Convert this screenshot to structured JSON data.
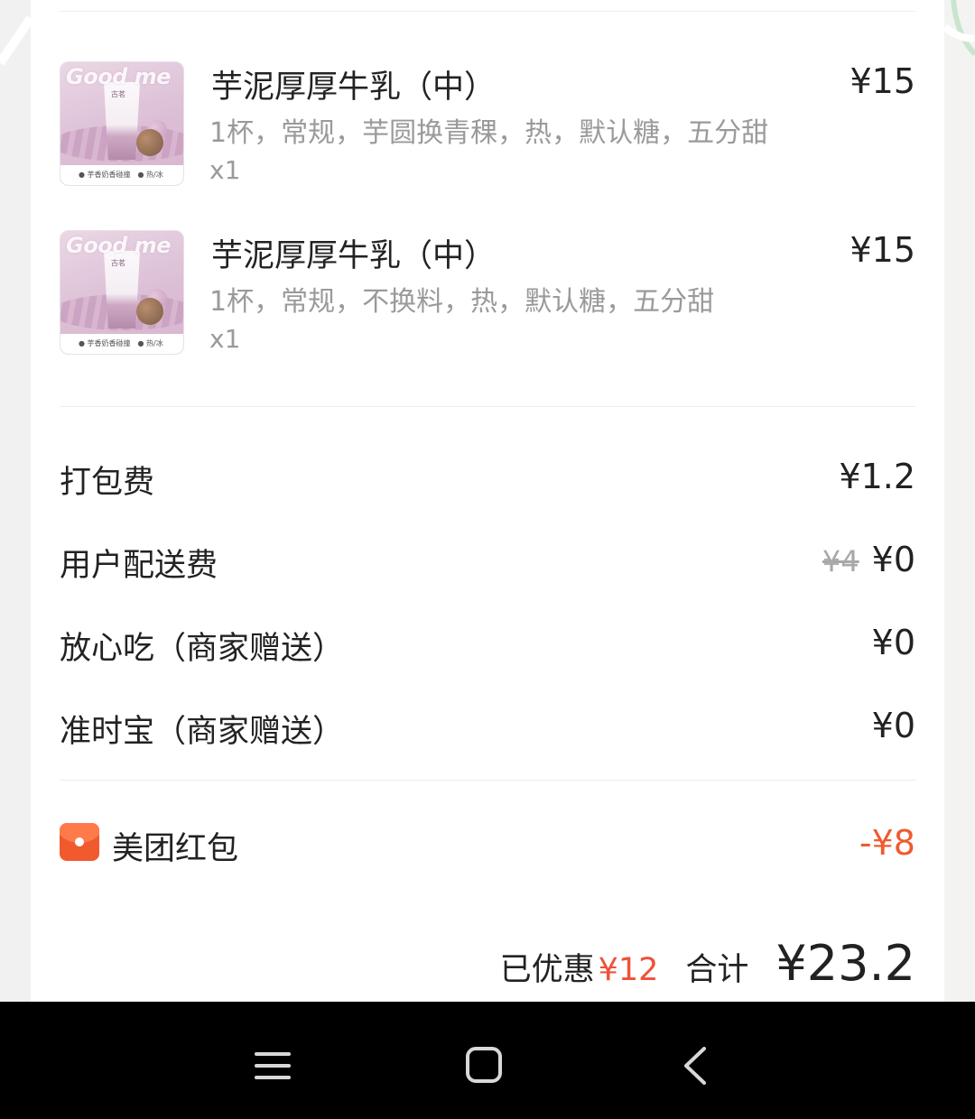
{
  "items": [
    {
      "name": "芋泥厚厚牛乳（中）",
      "spec": "1杯，常规，芋圆换青稞，热，默认糖，五分甜",
      "qty": "x1",
      "price": "¥15",
      "thumb": {
        "brand": "Good me",
        "cup_label": "古茗",
        "caption": "● 芋香奶香碰撞　● 热/冰"
      }
    },
    {
      "name": "芋泥厚厚牛乳（中）",
      "spec": "1杯，常规，不换料，热，默认糖，五分甜",
      "qty": "x1",
      "price": "¥15",
      "thumb": {
        "brand": "Good me",
        "cup_label": "古茗",
        "caption": "● 芋香奶香碰撞　● 热/冰"
      }
    }
  ],
  "fees": {
    "packing": {
      "label": "打包费",
      "value": "¥1.2"
    },
    "delivery": {
      "label": "用户配送费",
      "original": "¥4",
      "value": "¥0"
    },
    "safe_eat": {
      "label": "放心吃（商家赠送）",
      "value": "¥0"
    },
    "on_time": {
      "label": "准时宝（商家赠送）",
      "value": "¥0"
    }
  },
  "red_packet": {
    "label": "美团红包",
    "value": "-¥8",
    "icon": "red-envelope-icon"
  },
  "summary": {
    "saved_label": "已优惠",
    "saved_value": "¥12",
    "total_label": "合计",
    "total_value": "¥23.2"
  },
  "colors": {
    "accent": "#f05a2e",
    "saved": "#f0503a",
    "text": "#222222",
    "muted": "#9a9a9a"
  },
  "navbar": {
    "icons": [
      "menu-icon",
      "home-icon",
      "back-icon"
    ]
  }
}
